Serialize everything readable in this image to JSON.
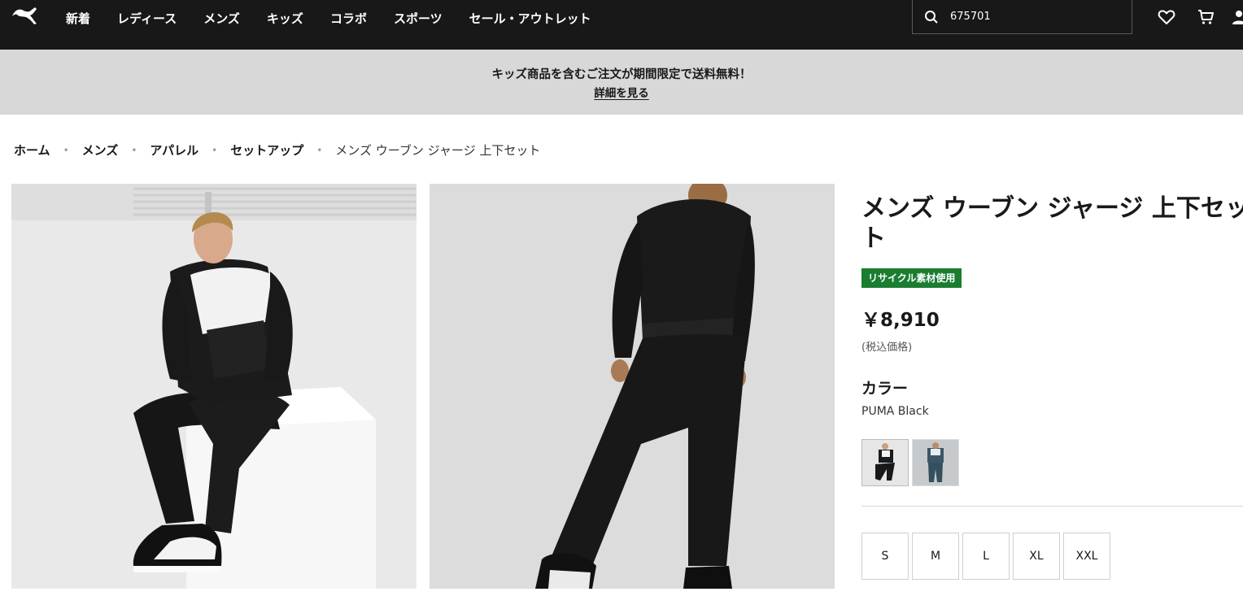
{
  "header": {
    "logo": "puma-logo",
    "nav_items": [
      "新着",
      "レディース",
      "メンズ",
      "キッズ",
      "コラボ",
      "スポーツ",
      "セール・アウトレット"
    ],
    "search_value": "675701",
    "icons": [
      "search-icon",
      "heart-icon",
      "cart-icon",
      "user-icon"
    ]
  },
  "promo": {
    "text": "キッズ商品を含むご注文が期間限定で送料無料！",
    "link": "詳細を見る"
  },
  "breadcrumb": {
    "items": [
      "ホーム",
      "メンズ",
      "アパレル",
      "セットアップ"
    ],
    "current": "メンズ ウーブン ジャージ 上下セット"
  },
  "product": {
    "title": "メンズ ウーブン ジャージ 上下セット",
    "badge": "リサイクル素材使用",
    "price": "￥8,910",
    "tax_note": "(税込価格)",
    "color_heading": "カラー",
    "color_name": "PUMA Black",
    "sizes": [
      "S",
      "M",
      "L",
      "XL",
      "XXL"
    ]
  },
  "colors": {
    "header_bg": "#181818",
    "promo_bg": "#d8d8d8",
    "badge_green": "#1a7d30"
  }
}
